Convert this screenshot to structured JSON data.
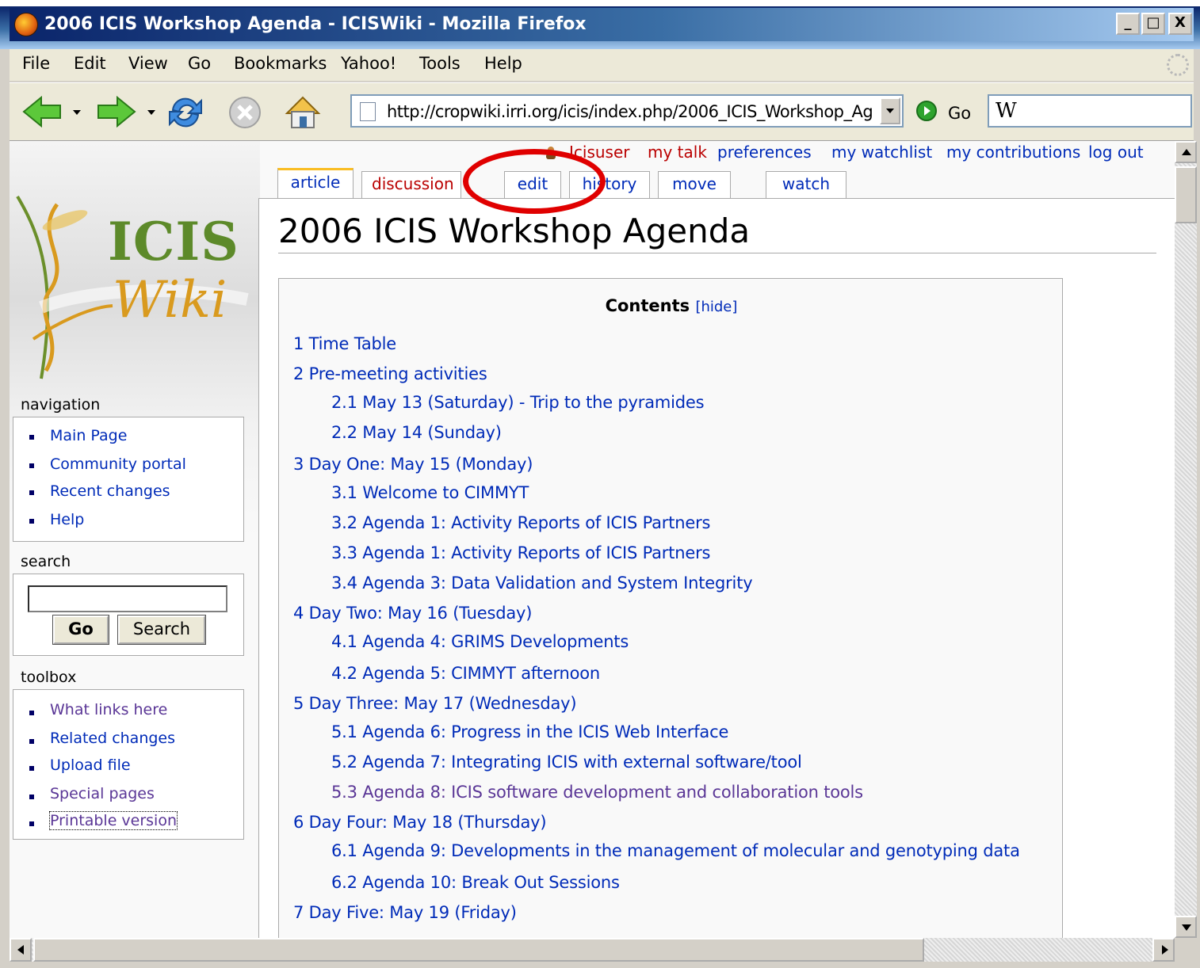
{
  "window": {
    "title": "2006 ICIS Workshop Agenda - ICISWiki - Mozilla Firefox",
    "minimize": "_",
    "maximize": "□",
    "close": "X"
  },
  "menu": [
    "File",
    "Edit",
    "View",
    "Go",
    "Bookmarks",
    "Yahoo!",
    "Tools",
    "Help"
  ],
  "toolbar": {
    "url": "http://cropwiki.irri.org/icis/index.php/2006_ICIS_Workshop_Ag",
    "go_label": "Go",
    "search_engine_glyph": "W"
  },
  "user_links": [
    "Icisuser",
    "my talk",
    "preferences",
    "my watchlist",
    "my contributions",
    "log out"
  ],
  "tabs": [
    "article",
    "discussion",
    "edit",
    "history",
    "move",
    "watch"
  ],
  "logo": {
    "line1": "ICIS",
    "line2": "Wiki"
  },
  "page": {
    "title": "2006 ICIS Workshop Agenda"
  },
  "toc": {
    "title": "Contents",
    "hide": "[hide]",
    "entries": [
      "1 Time Table",
      "2 Pre-meeting activities",
      "2.1 May 13 (Saturday) - Trip to the pyramides",
      "2.2 May 14 (Sunday)",
      "3 Day One: May 15 (Monday)",
      "3.1 Welcome to CIMMYT",
      "3.2 Agenda 1: Activity Reports of ICIS Partners",
      "3.3 Agenda 1: Activity Reports of ICIS Partners",
      "3.4 Agenda 3: Data Validation and System Integrity",
      "4 Day Two: May 16 (Tuesday)",
      "4.1 Agenda 4: GRIMS Developments",
      "4.2 Agenda 5: CIMMYT afternoon",
      "5 Day Three: May 17 (Wednesday)",
      "5.1 Agenda 6: Progress in the ICIS Web Interface",
      "5.2 Agenda 7: Integrating ICIS with external software/tool",
      "5.3 Agenda 8: ICIS software development and collaboration tools",
      "6 Day Four: May 18 (Thursday)",
      "6.1 Agenda 9: Developments in the management of molecular and genotyping data",
      "6.2 Agenda 10: Break Out Sessions",
      "7 Day Five: May 19 (Friday)"
    ]
  },
  "sidebar": {
    "navigation": {
      "heading": "navigation",
      "items": [
        "Main Page",
        "Community portal",
        "Recent changes",
        "Help"
      ]
    },
    "search": {
      "heading": "search",
      "go": "Go",
      "search": "Search"
    },
    "toolbox": {
      "heading": "toolbox",
      "items": [
        "What links here",
        "Related changes",
        "Upload file",
        "Special pages",
        "Printable version"
      ]
    }
  },
  "colors": {
    "link": "#002bb8",
    "visited_link": "#5a3696",
    "new_link": "#ba0000",
    "highlight": "#e00000"
  }
}
